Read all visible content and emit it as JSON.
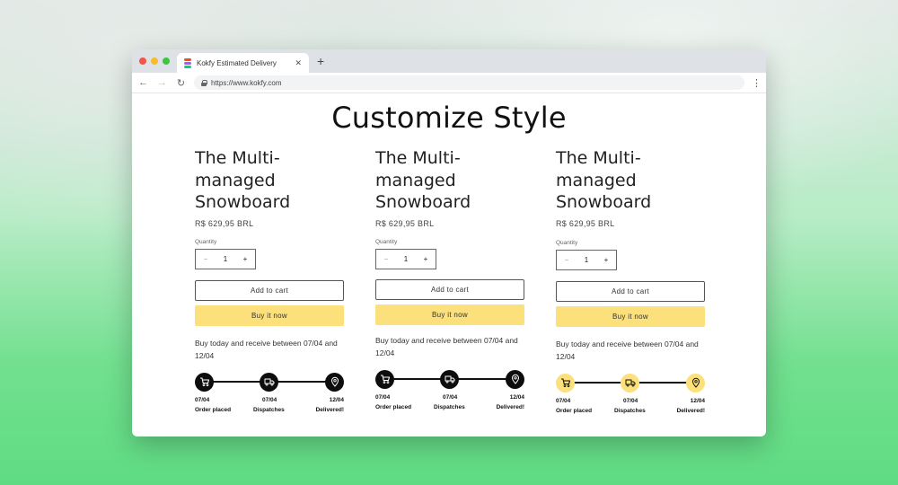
{
  "browser": {
    "tab_title": "Kokfy Estimated Delivery",
    "tab_close": "✕",
    "new_tab": "+",
    "back": "←",
    "forward": "→",
    "reload": "↻",
    "url": "https://www.kokfy.com",
    "menu": "⋮"
  },
  "page": {
    "headline": "Customize Style"
  },
  "cards": [
    {
      "title_line1": "The Multi-",
      "title_line2": "managed",
      "title_line3": "Snowboard",
      "price": "R$ 629,95 BRL",
      "quantity_label": "Quantity",
      "qty_minus": "−",
      "qty_value": "1",
      "qty_plus": "+",
      "add_to_cart": "Add to cart",
      "buy_now": "Buy it now",
      "delivery_text": "Buy today and receive between 07/04 and 12/04",
      "steps": [
        {
          "date": "07/04",
          "label": "Order placed",
          "icon": "cart-icon"
        },
        {
          "date": "07/04",
          "label": "Dispatches",
          "icon": "truck-icon"
        },
        {
          "date": "12/04",
          "label": "Delivered!",
          "icon": "location-pin-icon"
        }
      ]
    },
    {
      "title_line1": "The Multi-",
      "title_line2": "managed",
      "title_line3": "Snowboard",
      "price": "R$ 629,95 BRL",
      "quantity_label": "Quantity",
      "qty_minus": "−",
      "qty_value": "1",
      "qty_plus": "+",
      "add_to_cart": "Add to cart",
      "buy_now": "Buy it now",
      "delivery_text": "Buy today and receive between 07/04 and 12/04",
      "steps": [
        {
          "date": "07/04",
          "label": "Order placed",
          "icon": "cart-icon"
        },
        {
          "date": "07/04",
          "label": "Dispatches",
          "icon": "truck-icon"
        },
        {
          "date": "12/04",
          "label": "Delivered!",
          "icon": "location-pin-icon"
        }
      ]
    },
    {
      "title_line1": "The Multi-",
      "title_line2": "managed",
      "title_line3": "Snowboard",
      "price": "R$ 629,95 BRL",
      "quantity_label": "Quantity",
      "qty_minus": "−",
      "qty_value": "1",
      "qty_plus": "+",
      "add_to_cart": "Add to cart",
      "buy_now": "Buy it now",
      "delivery_text": "Buy today and receive between 07/04 and 12/04",
      "steps": [
        {
          "date": "07/04",
          "label": "Order placed",
          "icon": "cart-icon"
        },
        {
          "date": "07/04",
          "label": "Dispatches",
          "icon": "truck-icon"
        },
        {
          "date": "12/04",
          "label": "Delivered!",
          "icon": "location-pin-icon"
        }
      ]
    }
  ],
  "colors": {
    "accent_yellow": "#fbe07c",
    "timeline_dark": "#0d0d0d"
  }
}
